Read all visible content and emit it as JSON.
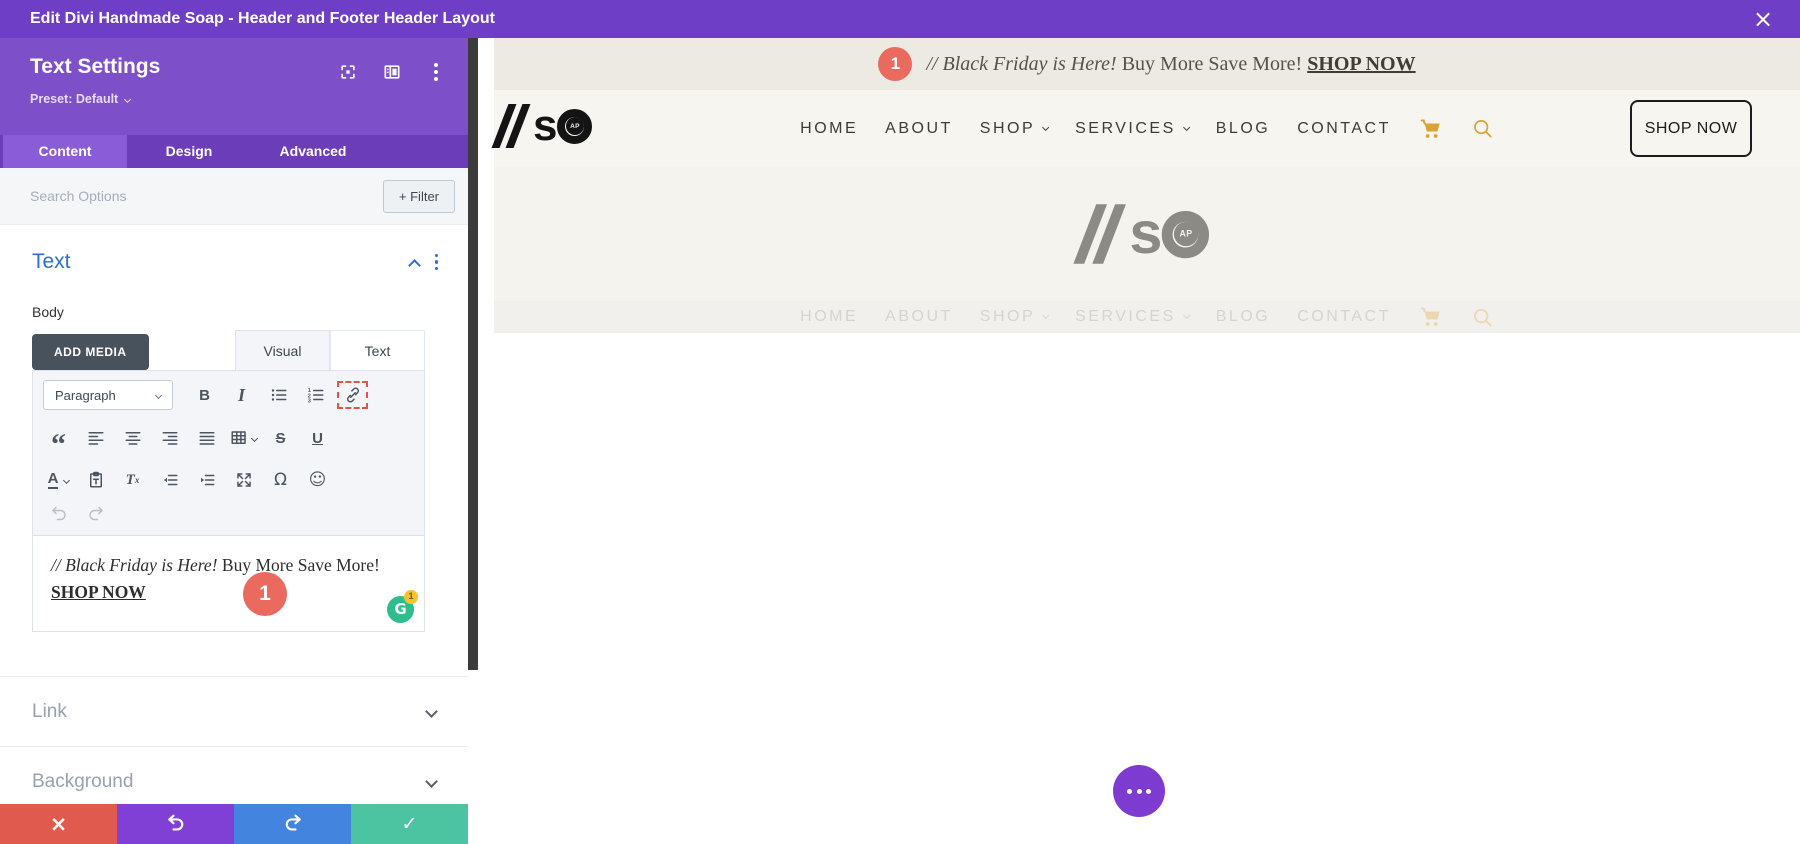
{
  "colors": {
    "builder_purple": "#6e3ec6",
    "panel_header_purple": "#7d4fc9",
    "tab_bar_purple": "#6b3db9",
    "active_tab_purple": "#8b5cd7",
    "accent_blue": "#2e6cd6",
    "annotation_red": "#ea6a5f",
    "action_red": "#e05a4e",
    "action_purple": "#8040d6",
    "action_blue": "#4284de",
    "action_green": "#4cc3a1",
    "grammarly_green": "#2dbe8c",
    "grammarly_yellow": "#f5c32f",
    "nav_gold": "#d9a437",
    "promo_bg": "#edeae3",
    "header_bg": "#f7f5f0",
    "hero_bg": "#f4f3ee",
    "fab_purple": "#7e3bd0"
  },
  "icons": {
    "close": "×",
    "check": "✓",
    "expand": "focus-crosshair",
    "dock": "columns-layout",
    "menu": "vertical-dots",
    "grammarly_glyph": "G"
  },
  "titlebar": {
    "title": "Edit Divi Handmade Soap - Header and Footer Header Layout",
    "close_glyph": "×"
  },
  "panel": {
    "title": "Text Settings",
    "preset_label": "Preset: Default",
    "tabs": [
      {
        "label": "Content",
        "active": true
      },
      {
        "label": "Design",
        "active": false
      },
      {
        "label": "Advanced",
        "active": false
      }
    ],
    "search": {
      "placeholder": "Search Options",
      "filter_label": "+ Filter"
    },
    "text_section": {
      "title": "Text",
      "field_label": "Body",
      "add_media_label": "ADD MEDIA",
      "editor_tabs": [
        {
          "label": "Visual",
          "active": true
        },
        {
          "label": "Text",
          "active": false
        }
      ],
      "toolbar": {
        "paragraph_label": "Paragraph",
        "glyphs": {
          "bold": "B",
          "italic": "I",
          "strikethrough": "S",
          "underline": "U",
          "text_color": "A",
          "remove_format_t": "T",
          "remove_format_x": "x",
          "special_character": "Ω",
          "emoticon": "☺",
          "blockquote": "“"
        }
      },
      "content": {
        "italic_text": "// Black Friday is Here!",
        "plain_text": "Buy More Save More!",
        "link_text": "SHOP NOW",
        "annotation_badge": "1",
        "grammarly_count": "1"
      }
    },
    "collapsed_sections": [
      {
        "label": "Link"
      },
      {
        "label": "Background"
      }
    ],
    "action_glyphs": {
      "close": "×",
      "save": "✓"
    }
  },
  "preview": {
    "promo_bar": {
      "annotation_badge": "1",
      "italic_text": "// Black Friday is Here!",
      "plain_text": "Buy More Save More!",
      "link_text": "SHOP NOW"
    },
    "logo": {
      "s": "s",
      "ap": "AP"
    },
    "nav": {
      "items": [
        {
          "label": "HOME"
        },
        {
          "label": "ABOUT"
        },
        {
          "label": "SHOP",
          "dropdown": true
        },
        {
          "label": "SERVICES",
          "dropdown": true
        },
        {
          "label": "BLOG"
        },
        {
          "label": "CONTACT"
        }
      ]
    },
    "header_button": "SHOP NOW"
  }
}
